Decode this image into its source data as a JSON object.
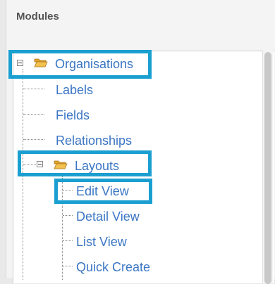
{
  "panel": {
    "title": "Modules"
  },
  "tree": {
    "root": {
      "label": "Organisations",
      "icon": "folder-open-icon",
      "children": [
        {
          "label": "Labels"
        },
        {
          "label": "Fields"
        },
        {
          "label": "Relationships"
        },
        {
          "label": "Layouts",
          "icon": "folder-open-icon",
          "children": [
            {
              "label": "Edit View"
            },
            {
              "label": "Detail View"
            },
            {
              "label": "List View"
            },
            {
              "label": "Quick Create"
            }
          ]
        }
      ]
    }
  },
  "colors": {
    "highlight": "#1a9fd0",
    "link": "#3a76c4",
    "folder": "#f2c14e"
  }
}
